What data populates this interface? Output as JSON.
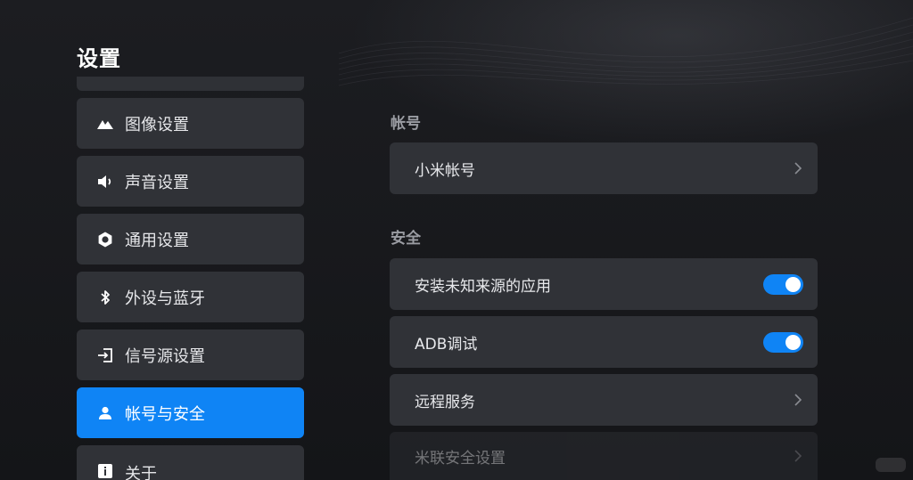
{
  "page": {
    "title": "设置"
  },
  "sidebar": {
    "items": [
      {
        "label": "图像设置",
        "icon": "image-mountain-icon",
        "active": false
      },
      {
        "label": "声音设置",
        "icon": "speaker-icon",
        "active": false
      },
      {
        "label": "通用设置",
        "icon": "gear-icon",
        "active": false
      },
      {
        "label": "外设与蓝牙",
        "icon": "bluetooth-icon",
        "active": false
      },
      {
        "label": "信号源设置",
        "icon": "input-source-icon",
        "active": false
      },
      {
        "label": "帐号与安全",
        "icon": "person-icon",
        "active": true
      },
      {
        "label": "关于",
        "icon": "info-icon",
        "active": false
      }
    ]
  },
  "main": {
    "account_section": {
      "title": "帐号",
      "rows": [
        {
          "label": "小米帐号",
          "control": "chevron"
        }
      ]
    },
    "security_section": {
      "title": "安全",
      "rows": [
        {
          "label": "安装未知来源的应用",
          "control": "toggle",
          "state": "on"
        },
        {
          "label": "ADB调试",
          "control": "toggle",
          "state": "on"
        },
        {
          "label": "远程服务",
          "control": "chevron"
        },
        {
          "label": "米联安全设置",
          "control": "chevron",
          "disabled": true
        }
      ]
    }
  },
  "colors": {
    "accent": "#0f84f5",
    "row_bg": "#303237",
    "background": "#16171a"
  }
}
